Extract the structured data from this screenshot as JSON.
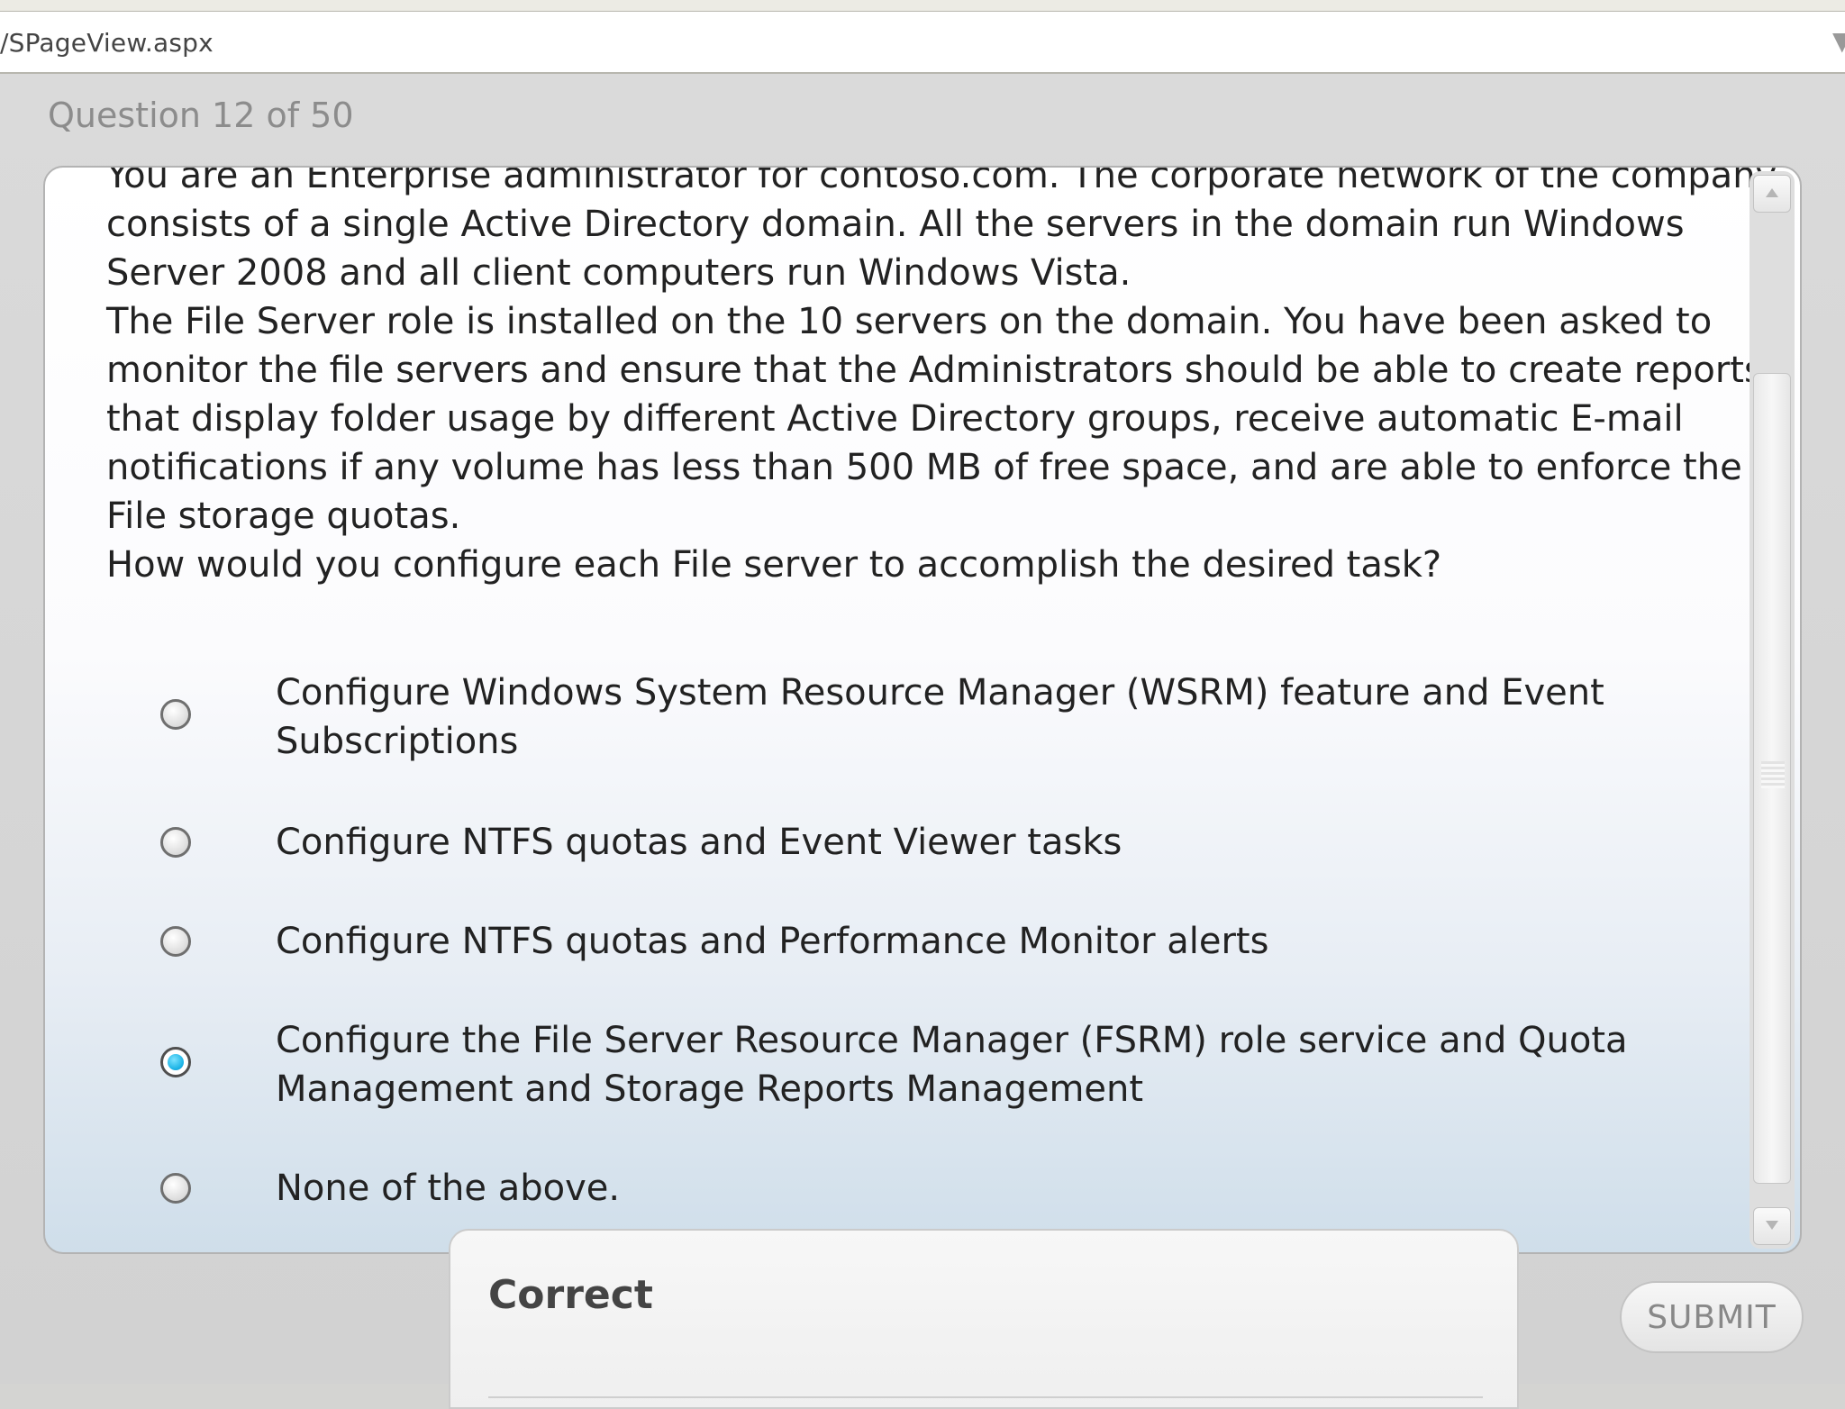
{
  "browser": {
    "address_text": "/SPageView.aspx"
  },
  "quiz": {
    "question_number": "Question 12 of 50",
    "question_text": "You are an Enterprise administrator for contoso.com. The corporate network of the company consists of a single Active Directory domain. All the servers in the domain run Windows Server 2008 and all client computers run Windows Vista.\nThe File Server role is installed on the 10 servers on the domain. You have been asked to monitor the file servers and ensure that the Administrators should be able to create reports that display folder usage by different Active Directory groups, receive automatic E-mail notifications if any volume has less than 500 MB of free space, and are able to enforce the File storage quotas.\nHow would you configure each File server to accomplish the desired task?",
    "options": [
      {
        "label": "Configure Windows System Resource Manager (WSRM) feature and Event Subscriptions",
        "selected": false
      },
      {
        "label": "Configure NTFS quotas and Event Viewer tasks",
        "selected": false
      },
      {
        "label": "Configure NTFS quotas and Performance Monitor alerts",
        "selected": false
      },
      {
        "label": "Configure the File Server Resource Manager (FSRM) role service and Quota Management and Storage Reports Management",
        "selected": true
      },
      {
        "label": "None of the above.",
        "selected": false
      }
    ],
    "feedback_title": "Correct",
    "submit_label": "SUBMIT"
  },
  "colors": {
    "selected_radio": "#1cb4e6",
    "text": "#222222",
    "muted_text": "#8c8c8c"
  }
}
